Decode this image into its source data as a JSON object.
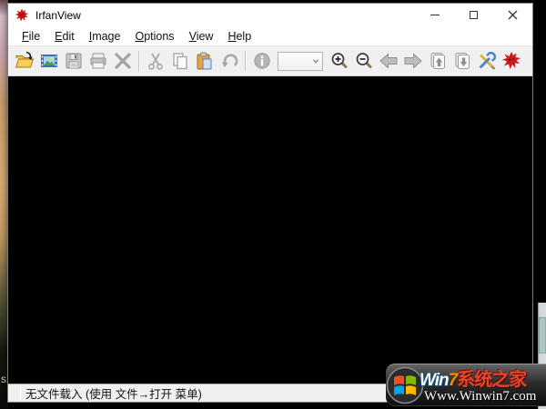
{
  "window": {
    "title": "IrfanView"
  },
  "menu": {
    "items": [
      {
        "key": "F",
        "rest": "ile"
      },
      {
        "key": "E",
        "rest": "dit"
      },
      {
        "key": "I",
        "rest": "mage"
      },
      {
        "key": "O",
        "rest": "ptions"
      },
      {
        "key": "V",
        "rest": "iew"
      },
      {
        "key": "H",
        "rest": "elp"
      }
    ]
  },
  "toolbar": {
    "zoom_select_value": "",
    "buttons": [
      "open-file",
      "slideshow",
      "save",
      "print",
      "delete",
      "cut",
      "copy",
      "paste",
      "undo",
      "image-info",
      "zoom-select",
      "zoom-in",
      "zoom-out",
      "previous-file",
      "next-file",
      "previous-page",
      "next-page",
      "properties-settings",
      "about-irfanview"
    ]
  },
  "statusbar": {
    "text": "无文件载入 (使用 文件→打开 菜单)"
  },
  "watermark": {
    "brand_win": "Win",
    "brand_seven": "7",
    "brand_cn": "系统之家",
    "url": "Www.Winwin7.com"
  },
  "desktop": {
    "partial_icon_text": "s"
  },
  "icons": {
    "irfanview-logo-icon": "red paint-splat cat",
    "open-folder-icon": "yellow open folder with arrow",
    "slideshow-icon": "filmstrip with landscape thumbnail",
    "save-icon": "gray floppy disk",
    "print-icon": "gray printer",
    "delete-icon": "gray X cross",
    "cut-icon": "gray scissors",
    "copy-icon": "two overlapping pages",
    "paste-icon": "clipboard with blue page",
    "undo-icon": "gray curved arrow",
    "info-icon": "gray circled i",
    "chevron-down-icon": "small down chevron",
    "zoom-in-icon": "magnifier with plus",
    "zoom-out-icon": "magnifier with minus",
    "back-arrow-icon": "gray left block arrow",
    "forward-arrow-icon": "gray right block arrow",
    "page-up-icon": "stacked pages with up arrow",
    "page-down-icon": "stacked pages with down arrow",
    "settings-icon": "crossed blue wrench and yellow screwdriver",
    "about-devil-icon": "red devil splat",
    "minimize-icon": "horizontal bar",
    "maximize-icon": "square outline",
    "close-icon": "x cross",
    "windows-flag-icon": "four color windows flag in dark circle"
  },
  "colors": {
    "titlebar_bg": "#ffffff",
    "toolbar_bg": "#f0f0f0",
    "canvas_bg": "#000000",
    "statusbar_bg": "#f0f0f0",
    "window_border": "#7e7e7e",
    "folder_yellow": "#f2c14b",
    "watermark_orange": "#ff8a00",
    "watermark_red": "#e8442c",
    "flag_red": "#f25022",
    "flag_green": "#7fba00",
    "flag_blue": "#00a4ef",
    "flag_yellow": "#ffb900"
  }
}
